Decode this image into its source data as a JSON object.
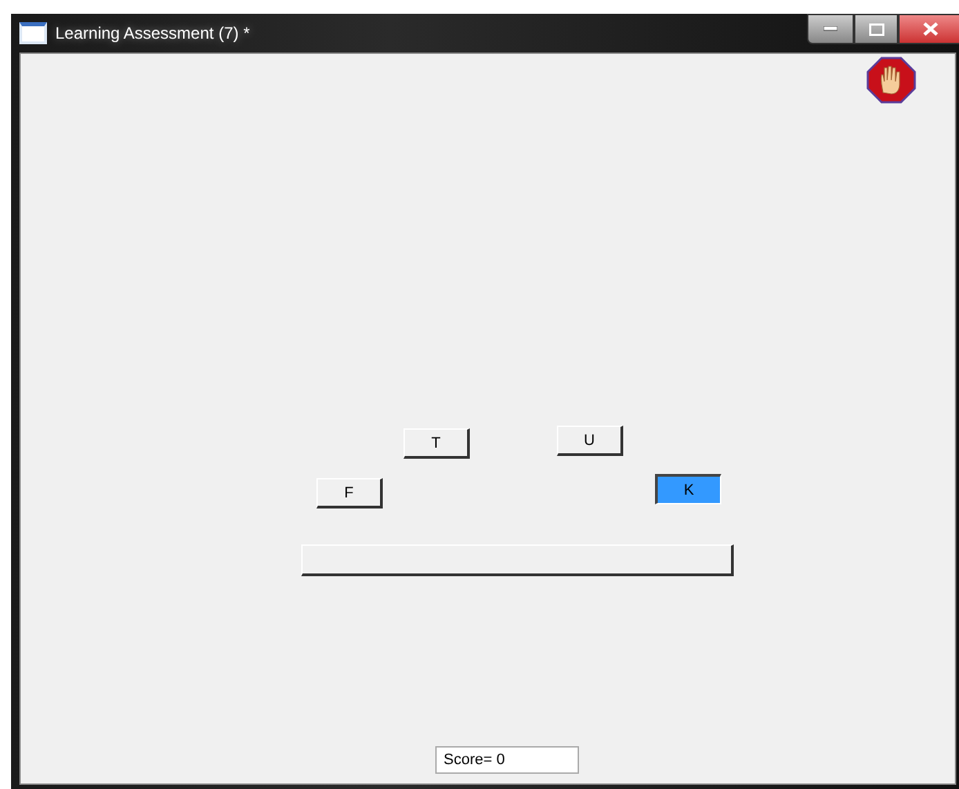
{
  "window": {
    "title": "Learning Assessment (7) *"
  },
  "letters": [
    {
      "label": "T",
      "selected": false
    },
    {
      "label": "U",
      "selected": false
    },
    {
      "label": "F",
      "selected": false
    },
    {
      "label": "K",
      "selected": true
    }
  ],
  "score": {
    "value": "Score= 0"
  }
}
